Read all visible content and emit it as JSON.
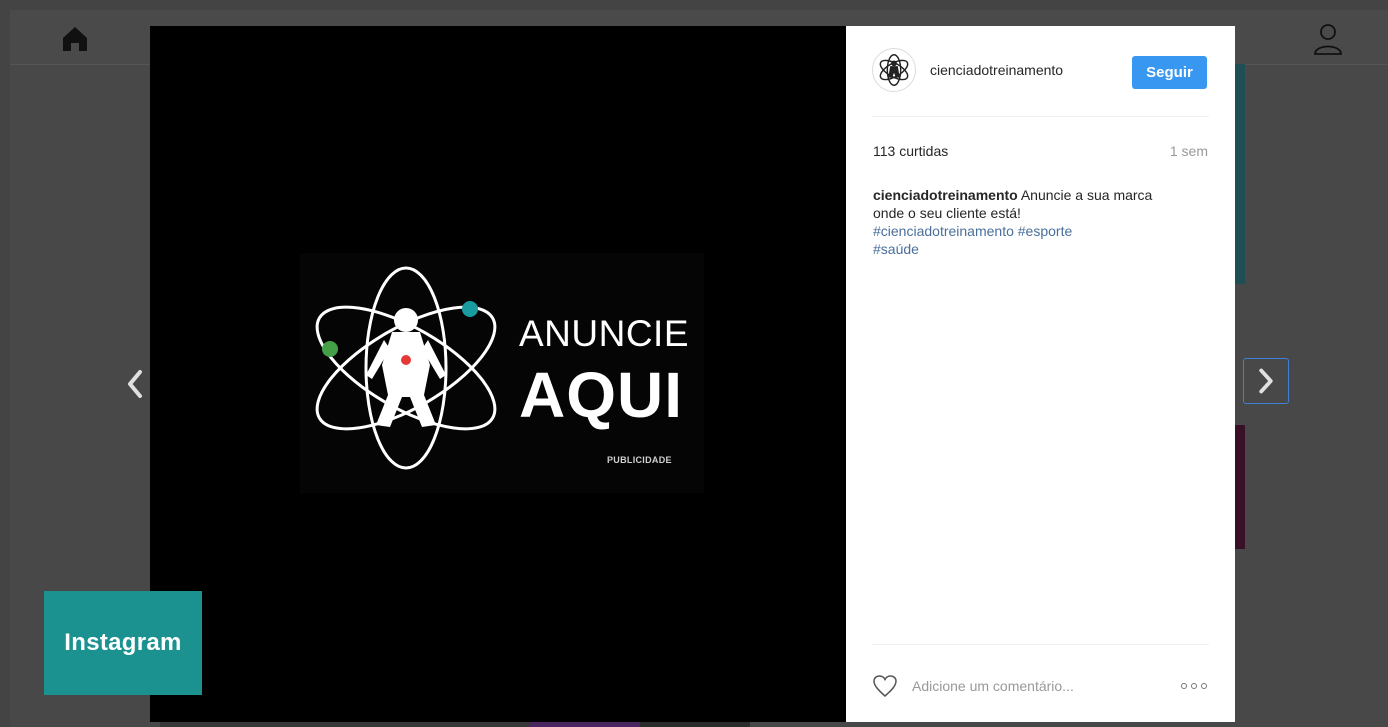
{
  "post": {
    "author": "cienciadotreinamento",
    "follow_label": "Seguir",
    "likes": "113 curtidas",
    "time": "1 sem",
    "caption_text": " Anuncie a sua marca onde o seu cliente está!",
    "hashtags": [
      "#cienciadotreinamento",
      "#esporte",
      "#saúde"
    ],
    "comment_placeholder": "Adicione um comentário..."
  },
  "ad": {
    "line1": "ANUNCIE",
    "line2": "AQUI",
    "tag": "PUBLICIDADE"
  },
  "badge": {
    "label": "Instagram"
  },
  "icons": {
    "home": "home-icon",
    "profile": "profile-icon",
    "heart": "heart-icon",
    "more": "more-options-icon",
    "prev": "chevron-left-icon",
    "next": "chevron-right-icon"
  },
  "colors": {
    "accent": "#3897f0",
    "badge": "#1b9290",
    "hashtag": "#4a6f9a"
  }
}
